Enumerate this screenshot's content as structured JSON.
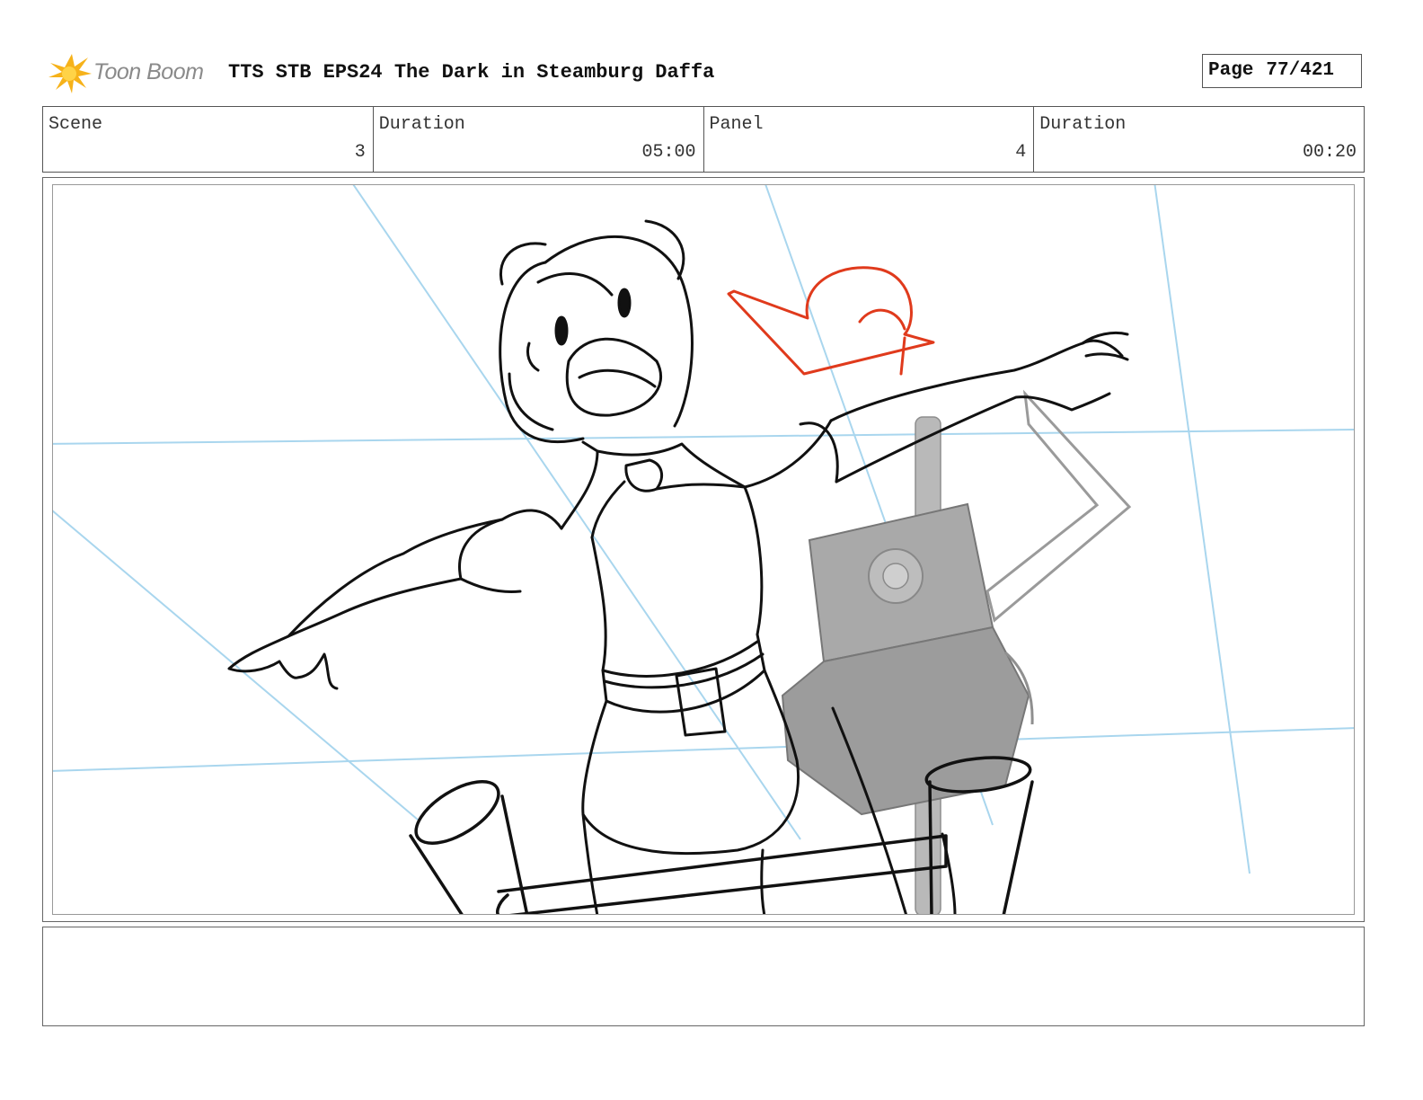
{
  "header": {
    "brand": "Toon Boom",
    "title": "TTS STB EPS24 The Dark in Steamburg Daffa",
    "page_label": "Page",
    "page_value": "77/421"
  },
  "info": {
    "scene_label": "Scene",
    "scene_value": "3",
    "scene_duration_label": "Duration",
    "scene_duration_value": "05:00",
    "panel_label": "Panel",
    "panel_value": "4",
    "panel_duration_label": "Duration",
    "panel_duration_value": "00:20"
  },
  "panel": {
    "guide_color": "#a9d6ee",
    "sketch_color": "#111111",
    "accent_color": "#e03a1c",
    "prop_color": "#9a9a9a"
  },
  "caption": ""
}
